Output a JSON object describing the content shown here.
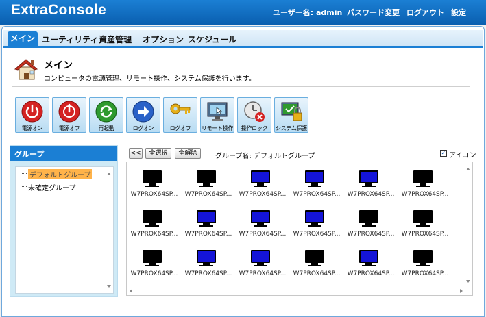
{
  "header": {
    "app_title": "ExtraConsole",
    "user_label": "ユーザー名: admin",
    "password_change": "パスワード変更",
    "logout": "ログアウト",
    "settings": "設定"
  },
  "tabs": [
    "メイン",
    "ユーティリティ",
    "資産管理",
    "オプション",
    "スケジュール"
  ],
  "page": {
    "title": "メイン",
    "description": "コンピュータの電源管理、リモート操作、システム保護を行います。"
  },
  "toolbar": [
    {
      "label": "電源オン",
      "icon": "power-on-icon"
    },
    {
      "label": "電源オフ",
      "icon": "power-off-icon"
    },
    {
      "label": "再起動",
      "icon": "restart-icon"
    },
    {
      "label": "ログオン",
      "icon": "logon-icon"
    },
    {
      "label": "ログオフ",
      "icon": "key-icon"
    },
    {
      "label": "リモート操作",
      "icon": "remote-control-icon"
    },
    {
      "label": "操作ロック",
      "icon": "lock-clock-icon"
    },
    {
      "label": "システム保護",
      "icon": "system-protect-icon"
    }
  ],
  "group_panel": {
    "header": "グループ",
    "items": [
      "デフォルトグループ",
      "未確定グループ"
    ],
    "selected": "デフォルトグループ"
  },
  "controls": {
    "back": "<<",
    "select_all": "全選択",
    "deselect_all": "全解除",
    "group_name": "グループ名: デフォルトグループ",
    "icon_checkbox_label": "アイコン",
    "icon_checked": true
  },
  "computers": [
    {
      "name": "W7PROX64SP...",
      "screen": "black"
    },
    {
      "name": "W7PROX64SP...",
      "screen": "black"
    },
    {
      "name": "W7PROX64SP...",
      "screen": "blue"
    },
    {
      "name": "W7PROX64SP...",
      "screen": "blue"
    },
    {
      "name": "W7PROX64SP...",
      "screen": "blue"
    },
    {
      "name": "W7PROX64SP...",
      "screen": "black"
    },
    {
      "name": "W7PROX64SP...",
      "screen": "black"
    },
    {
      "name": "W7PROX64SP...",
      "screen": "blue"
    },
    {
      "name": "W7PROX64SP...",
      "screen": "blue"
    },
    {
      "name": "W7PROX64SP...",
      "screen": "blue"
    },
    {
      "name": "W7PROX64SP...",
      "screen": "black"
    },
    {
      "name": "W7PROX64SP...",
      "screen": "black"
    },
    {
      "name": "W7PROX64SP...",
      "screen": "black"
    },
    {
      "name": "W7PROX64SP...",
      "screen": "blue"
    },
    {
      "name": "W7PROX64SP...",
      "screen": "blue"
    },
    {
      "name": "W7PROX64SP...",
      "screen": "black"
    },
    {
      "name": "W7PROX64SP...",
      "screen": "blue"
    },
    {
      "name": "W7PROX64SP...",
      "screen": "black"
    }
  ],
  "colors": {
    "accent": "#1b7fd4",
    "screen_black": "#000000",
    "screen_blue": "#1414d8",
    "selection": "#ffb34a"
  }
}
